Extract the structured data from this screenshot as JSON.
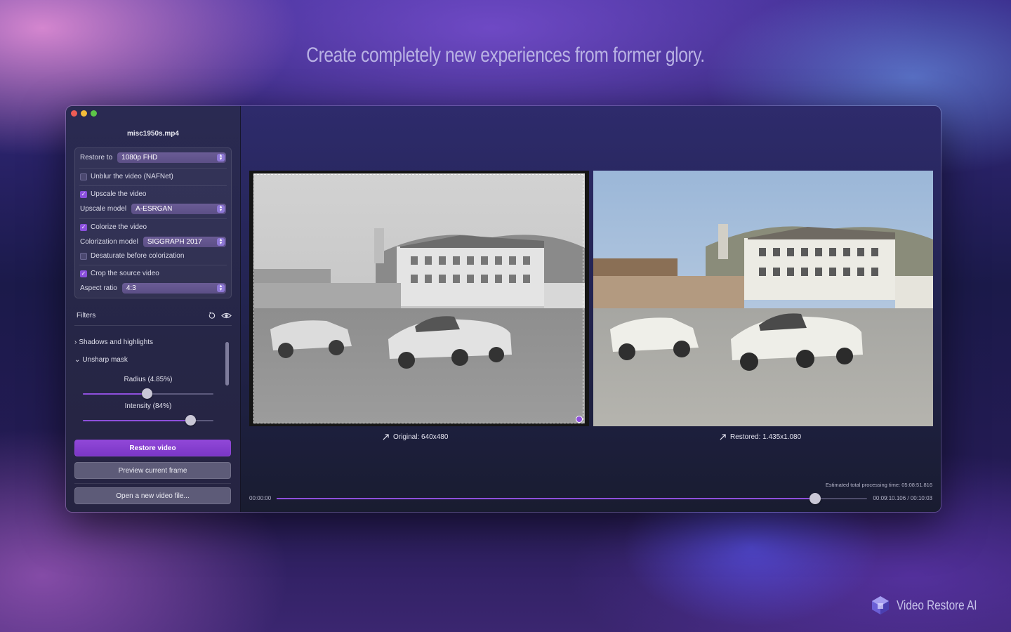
{
  "headline": "Create completely new experiences from former glory.",
  "brand": {
    "name": "Video Restore AI",
    "logo_icon": "hexagon-cube-logo"
  },
  "window": {
    "title": "misc1950s.mp4"
  },
  "settings": {
    "restore_to_label": "Restore to",
    "restore_to_value": "1080p FHD",
    "unblur_label": "Unblur the video (NAFNet)",
    "unblur_checked": false,
    "upscale_label": "Upscale the video",
    "upscale_checked": true,
    "upscale_model_label": "Upscale model",
    "upscale_model_value": "A-ESRGAN",
    "colorize_label": "Colorize the video",
    "colorize_checked": true,
    "colorization_model_label": "Colorization model",
    "colorization_model_value": "SIGGRAPH 2017",
    "desaturate_label": "Desaturate before colorization",
    "desaturate_checked": false,
    "crop_label": "Crop the source video",
    "crop_checked": true,
    "aspect_ratio_label": "Aspect ratio",
    "aspect_ratio_value": "4:3"
  },
  "filters": {
    "title": "Filters",
    "sections": [
      {
        "label": "Shadows and highlights",
        "expanded": false
      },
      {
        "label": "Unsharp mask",
        "expanded": true
      }
    ],
    "radius": {
      "label": "Radius (4.85%)",
      "value_fraction": 0.49
    },
    "intensity": {
      "label": "Intensity (84%)",
      "value_fraction": 0.82
    }
  },
  "actions": {
    "restore": "Restore video",
    "preview": "Preview current frame",
    "open": "Open a new video file..."
  },
  "preview": {
    "original_caption": "Original: 640x480",
    "restored_caption": "Restored: 1.435x1.080"
  },
  "timeline": {
    "start": "00:00:00",
    "position": "00:09:10.106 / 00:10:03",
    "estimated": "Estimated total processing time: 05:08:51.816",
    "progress_fraction": 0.912
  },
  "colors": {
    "accent": "#8E4FDC",
    "window_bg": "#262646"
  }
}
